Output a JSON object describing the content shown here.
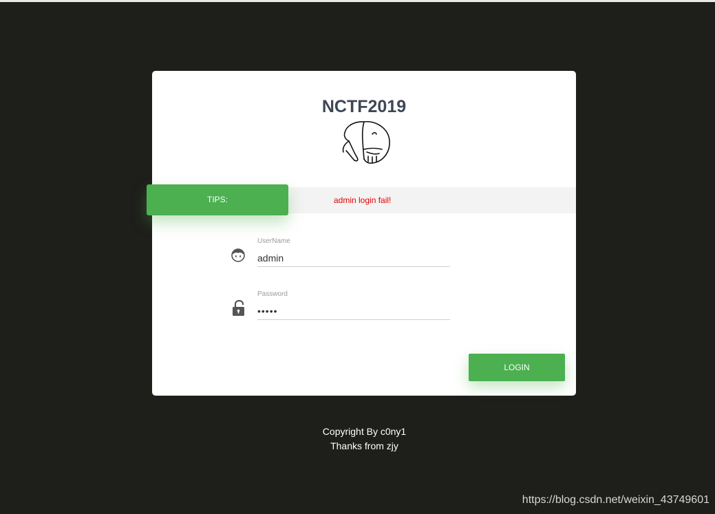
{
  "title": "NCTF2019",
  "tips": {
    "label": "TIPS:",
    "message": "admin login fail!"
  },
  "form": {
    "username_label": "UserName",
    "username_value": "admin",
    "password_label": "Password",
    "password_value": "admin",
    "login_label": "LOGIN"
  },
  "footer": {
    "line1": "Copyright By c0ny1",
    "line2": "Thanks from zjy"
  },
  "watermark": "https://blog.csdn.net/weixin_43749601",
  "colors": {
    "background": "#1e1e1a",
    "accent": "#4caf50",
    "error": "#e00000",
    "title": "#3d4756"
  },
  "icons": {
    "logo": "elephant-logo",
    "username": "user-face-icon",
    "password": "unlock-icon"
  }
}
